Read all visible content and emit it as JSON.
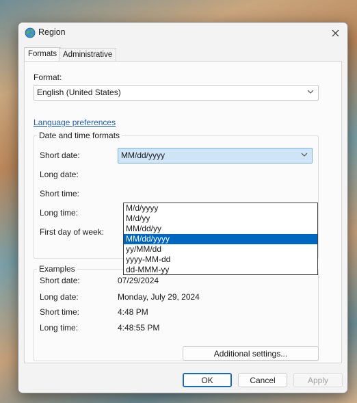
{
  "window": {
    "title": "Region",
    "icon": "globe-icon"
  },
  "tabs": [
    {
      "label": "Formats"
    },
    {
      "label": "Administrative"
    }
  ],
  "format": {
    "label": "Format:",
    "value": "English (United States)"
  },
  "language_link": "Language preferences",
  "date_time": {
    "group_title": "Date and time formats",
    "short_date": {
      "label": "Short date:",
      "value": "MM/dd/yyyy"
    },
    "long_date": {
      "label": "Long date:"
    },
    "short_time": {
      "label": "Short time:"
    },
    "long_time": {
      "label": "Long time:"
    },
    "first_day": {
      "label": "First day of week:"
    },
    "dropdown_options": [
      "M/d/yyyy",
      "M/d/yy",
      "MM/dd/yy",
      "MM/dd/yyyy",
      "yy/MM/dd",
      "yyyy-MM-dd",
      "dd-MMM-yy"
    ],
    "selected_option": "MM/dd/yyyy"
  },
  "examples": {
    "group_title": "Examples",
    "rows": [
      {
        "label": "Short date:",
        "value": "07/29/2024"
      },
      {
        "label": "Long date:",
        "value": "Monday, July 29, 2024"
      },
      {
        "label": "Short time:",
        "value": "4:48 PM"
      },
      {
        "label": "Long time:",
        "value": "4:48:55 PM"
      }
    ]
  },
  "buttons": {
    "additional_settings": "Additional settings...",
    "ok": "OK",
    "cancel": "Cancel",
    "apply": "Apply"
  },
  "colors": {
    "accent": "#0067c0",
    "link": "#1f5fae"
  }
}
